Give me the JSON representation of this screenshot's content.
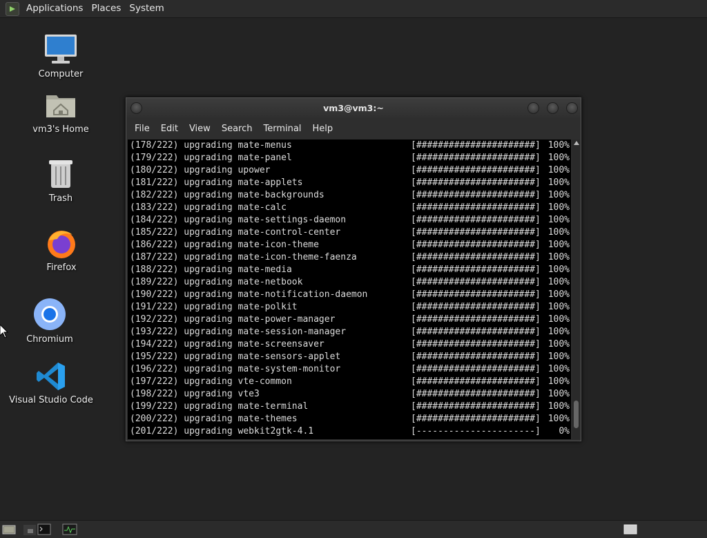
{
  "top_panel": {
    "menus": [
      "Applications",
      "Places",
      "System"
    ]
  },
  "desktop": {
    "icons": [
      {
        "label": "Computer",
        "icon": "computer-icon"
      },
      {
        "label": "vm3's Home",
        "icon": "home-folder-icon"
      },
      {
        "label": "Trash",
        "icon": "trash-icon"
      },
      {
        "label": "Firefox",
        "icon": "firefox-icon"
      },
      {
        "label": "Chromium",
        "icon": "chromium-icon"
      },
      {
        "label": "Visual Studio Code",
        "icon": "vscode-icon"
      }
    ]
  },
  "terminal": {
    "title": "vm3@vm3:~",
    "menus": [
      "File",
      "Edit",
      "View",
      "Search",
      "Terminal",
      "Help"
    ],
    "lines": [
      {
        "text": "(178/222) upgrading mate-menus",
        "progress": "[######################]",
        "pct": "100%"
      },
      {
        "text": "(179/222) upgrading mate-panel",
        "progress": "[######################]",
        "pct": "100%"
      },
      {
        "text": "(180/222) upgrading upower",
        "progress": "[######################]",
        "pct": "100%"
      },
      {
        "text": "(181/222) upgrading mate-applets",
        "progress": "[######################]",
        "pct": "100%"
      },
      {
        "text": "(182/222) upgrading mate-backgrounds",
        "progress": "[######################]",
        "pct": "100%"
      },
      {
        "text": "(183/222) upgrading mate-calc",
        "progress": "[######################]",
        "pct": "100%"
      },
      {
        "text": "(184/222) upgrading mate-settings-daemon",
        "progress": "[######################]",
        "pct": "100%"
      },
      {
        "text": "(185/222) upgrading mate-control-center",
        "progress": "[######################]",
        "pct": "100%"
      },
      {
        "text": "(186/222) upgrading mate-icon-theme",
        "progress": "[######################]",
        "pct": "100%"
      },
      {
        "text": "(187/222) upgrading mate-icon-theme-faenza",
        "progress": "[######################]",
        "pct": "100%"
      },
      {
        "text": "(188/222) upgrading mate-media",
        "progress": "[######################]",
        "pct": "100%"
      },
      {
        "text": "(189/222) upgrading mate-netbook",
        "progress": "[######################]",
        "pct": "100%"
      },
      {
        "text": "(190/222) upgrading mate-notification-daemon",
        "progress": "[######################]",
        "pct": "100%"
      },
      {
        "text": "(191/222) upgrading mate-polkit",
        "progress": "[######################]",
        "pct": "100%"
      },
      {
        "text": "(192/222) upgrading mate-power-manager",
        "progress": "[######################]",
        "pct": "100%"
      },
      {
        "text": "(193/222) upgrading mate-session-manager",
        "progress": "[######################]",
        "pct": "100%"
      },
      {
        "text": "(194/222) upgrading mate-screensaver",
        "progress": "[######################]",
        "pct": "100%"
      },
      {
        "text": "(195/222) upgrading mate-sensors-applet",
        "progress": "[######################]",
        "pct": "100%"
      },
      {
        "text": "(196/222) upgrading mate-system-monitor",
        "progress": "[######################]",
        "pct": "100%"
      },
      {
        "text": "(197/222) upgrading vte-common",
        "progress": "[######################]",
        "pct": "100%"
      },
      {
        "text": "(198/222) upgrading vte3",
        "progress": "[######################]",
        "pct": "100%"
      },
      {
        "text": "(199/222) upgrading mate-terminal",
        "progress": "[######################]",
        "pct": "100%"
      },
      {
        "text": "(200/222) upgrading mate-themes",
        "progress": "[######################]",
        "pct": "100%"
      },
      {
        "text": "(201/222) upgrading webkit2gtk-4.1",
        "progress": "[----------------------]",
        "pct": "0%"
      }
    ]
  },
  "bottom_panel": {
    "items": [
      "show-desktop-icon",
      "workspace-icon",
      "terminal-launcher-icon",
      "system-monitor-icon",
      "workspace-switcher-icon"
    ]
  },
  "colors": {
    "desktop_bg": "#232323",
    "panel_bg": "#2b2b2b",
    "terminal_bg": "#000000"
  }
}
